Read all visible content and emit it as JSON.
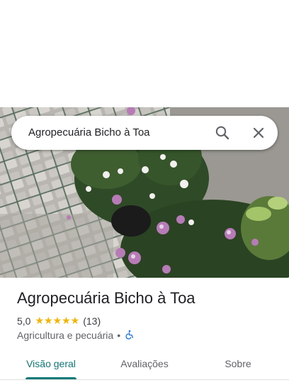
{
  "search": {
    "query": "Agropecuária Bicho à Toa",
    "search_icon": "search-icon",
    "close_icon": "close-icon"
  },
  "place": {
    "name": "Agropecuária Bicho à Toa",
    "rating": "5,0",
    "stars": "★★★★★",
    "review_count": "(13)",
    "category": "Agricultura e pecuária",
    "separator": "•",
    "accessibility_icon": "wheelchair-icon"
  },
  "tabs": [
    {
      "label": "Visão geral",
      "active": true
    },
    {
      "label": "Avaliações",
      "active": false
    },
    {
      "label": "Sobre",
      "active": false
    }
  ],
  "colors": {
    "accent": "#0b7a78",
    "star": "#f4b400",
    "accessibility": "#1a73e8"
  }
}
